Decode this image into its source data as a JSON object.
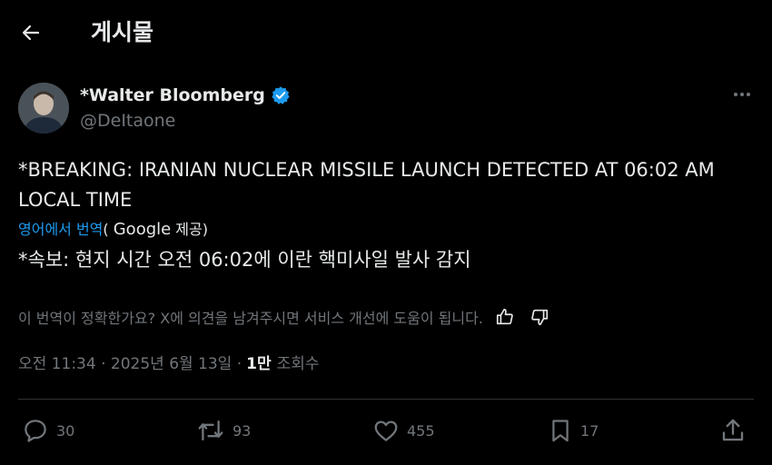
{
  "header": {
    "title": "게시물"
  },
  "author": {
    "name": "*Walter Bloomberg",
    "handle": "@DeItaone"
  },
  "tweet": {
    "text": "*BREAKING: IRANIAN NUCLEAR MISSILE LAUNCH DETECTED AT 06:02 AM LOCAL TIME",
    "translation_link": "영어에서 번역",
    "translation_provider_open": "( ",
    "translation_provider": "Google",
    "translation_provider_close": " 제공)",
    "translated_text": "*속보: 현지 시간 오전 06:02에 이란 핵미사일 발사 감지",
    "feedback_prompt": "이 번역이 정확한가요? X에 의견을 남겨주시면 서비스 개선에 도움이 됩니다."
  },
  "meta": {
    "timestamp": "오전 11:34 · 2025년 6월 13일 · ",
    "views_count": "1만",
    "views_label": "조회수"
  },
  "actions": {
    "replies": "30",
    "reposts": "93",
    "likes": "455",
    "bookmarks": "17"
  },
  "colors": {
    "background": "#000000",
    "text": "#e7e9ea",
    "muted": "#71767b",
    "link": "#1d9bf0",
    "verified": "#1d9bf0",
    "divider": "#2f3336"
  }
}
